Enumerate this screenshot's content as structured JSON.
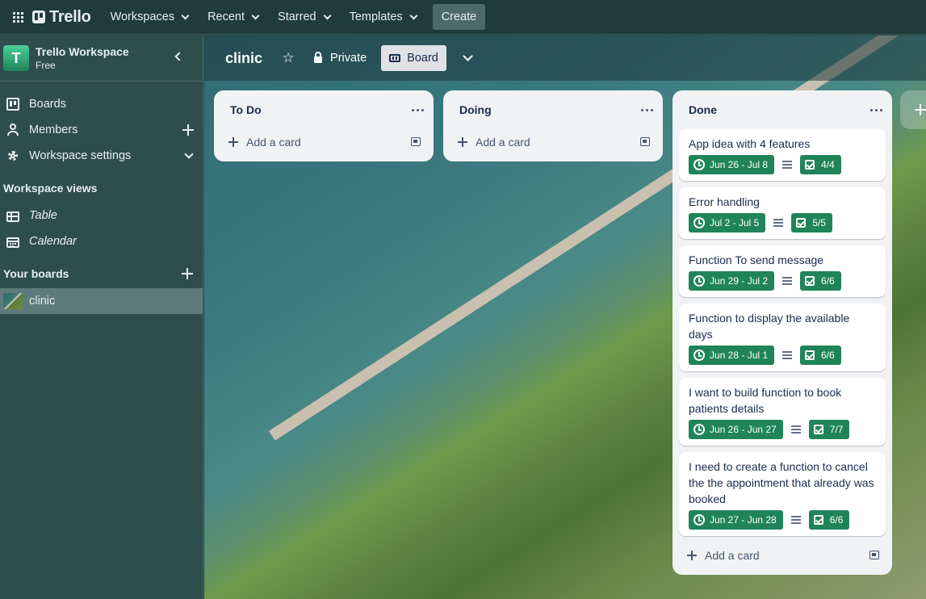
{
  "topbar": {
    "logo": "Trello",
    "nav": [
      "Workspaces",
      "Recent",
      "Starred",
      "Templates"
    ],
    "create_label": "Create"
  },
  "sidebar": {
    "workspace_initial": "T",
    "workspace_name": "Trello Workspace",
    "workspace_plan": "Free",
    "items": [
      {
        "label": "Boards",
        "icon": "board-icon"
      },
      {
        "label": "Members",
        "icon": "members-icon"
      },
      {
        "label": "Workspace settings",
        "icon": "gear-icon"
      }
    ],
    "views_heading": "Workspace views",
    "views": [
      {
        "label": "Table",
        "icon": "table-icon"
      },
      {
        "label": "Calendar",
        "icon": "calendar-icon"
      }
    ],
    "your_boards_heading": "Your boards",
    "boards": [
      {
        "label": "clinic"
      }
    ]
  },
  "board": {
    "title": "clinic",
    "visibility_label": "Private",
    "view_label": "Board",
    "lists": [
      {
        "title": "To Do",
        "add_card_label": "Add a card",
        "cards": []
      },
      {
        "title": "Doing",
        "add_card_label": "Add a card",
        "cards": []
      },
      {
        "title": "Done",
        "add_card_label": "Add a card",
        "cards": [
          {
            "title": "App idea with 4 features",
            "dates": "Jun 26 - Jul 8",
            "checklist": "4/4"
          },
          {
            "title": "Error handling",
            "dates": "Jul 2 - Jul 5",
            "checklist": "5/5"
          },
          {
            "title": "Function To send message",
            "dates": "Jun 29 - Jul 2",
            "checklist": "6/6"
          },
          {
            "title": "Function to display the available days",
            "dates": "Jun 28 - Jul 1",
            "checklist": "6/6"
          },
          {
            "title": "I want to build function to book patients details",
            "dates": "Jun 26 - Jun 27",
            "checklist": "7/7"
          },
          {
            "title": "I need to create a function to cancel the the appointment that already was booked",
            "dates": "Jun 27 - Jun 28",
            "checklist": "6/6"
          }
        ]
      }
    ]
  },
  "colors": {
    "due_badge": "#1f845a",
    "list_bg": "#f1f2f4",
    "topbar_bg": "#1f3b3c",
    "sidebar_bg": "#2e4e4d"
  }
}
